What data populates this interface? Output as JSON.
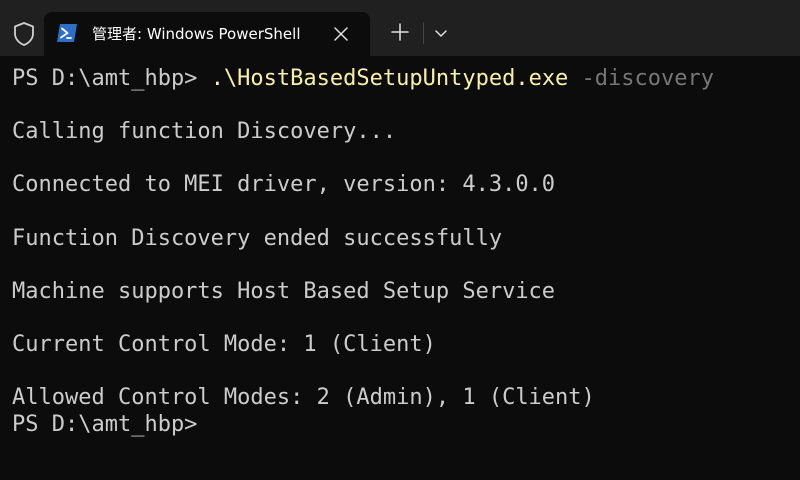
{
  "window": {
    "tab_title": "管理者: Windows PowerShell"
  },
  "icons": {
    "shield": "shield-icon",
    "powershell": "powershell-icon",
    "close": "close-icon",
    "new_tab": "plus-icon",
    "dropdown": "chevron-down-icon"
  },
  "terminal": {
    "prompt1": "PS D:\\amt_hbp> ",
    "command": ".\\HostBasedSetupUntyped.exe",
    "argument": " -discovery",
    "output": [
      "Calling function Discovery...",
      "Connected to MEI driver, version: 4.3.0.0",
      "Function Discovery ended successfully",
      "Machine supports Host Based Setup Service",
      "Current Control Mode: 1 (Client)",
      "Allowed Control Modes: 2 (Admin), 1 (Client)"
    ],
    "prompt2": "PS D:\\amt_hbp>"
  },
  "colors": {
    "background": "#0c0c0c",
    "titlebar": "#202020",
    "text": "#cccccc",
    "command": "#f9f1a5",
    "parameter": "#767676"
  }
}
